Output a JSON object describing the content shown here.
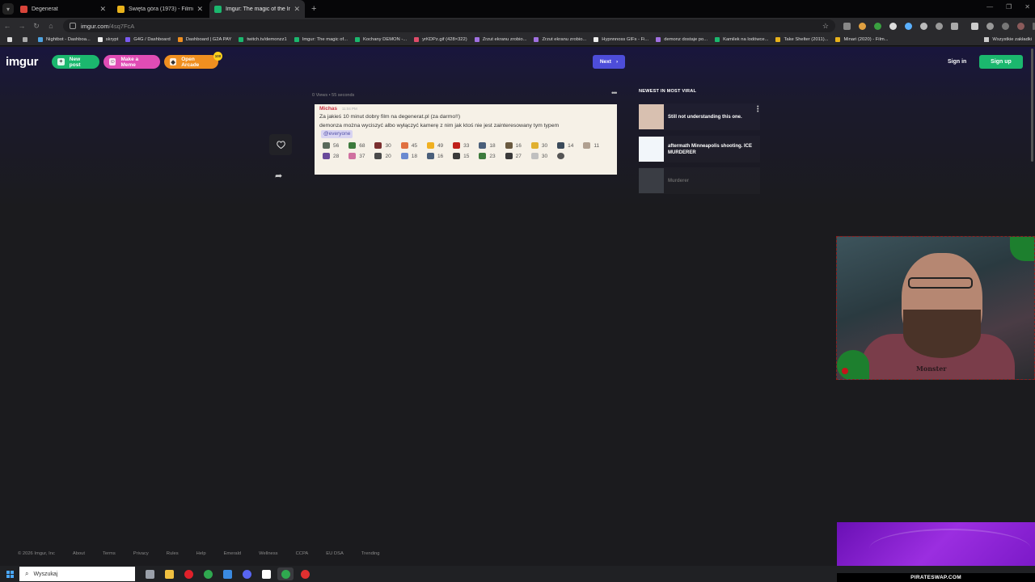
{
  "browser": {
    "tabs": [
      {
        "title": "Degenerat",
        "favicon_color": "#d8443a",
        "active": false
      },
      {
        "title": "Święta góra (1973) - Filmweb",
        "favicon_color": "#e8b21b",
        "active": false
      },
      {
        "title": "Imgur: The magic of the Internet",
        "favicon_color": "#1bb76e",
        "active": true
      }
    ],
    "url_host": "imgur.com",
    "url_path": "/4sq7FcA",
    "bookmarks": [
      {
        "label": "Nightbot - Dashboa...",
        "color": "#4fa3e0"
      },
      {
        "label": "skrypt",
        "color": "#eeeeee"
      },
      {
        "label": "G4G / Dashboard",
        "color": "#7a5af0"
      },
      {
        "label": "Dashboard | G2A PAY",
        "color": "#f08f20"
      },
      {
        "label": "twitch.tv/demonzz1",
        "color": "#1bb76e"
      },
      {
        "label": "Imgur: The magic of...",
        "color": "#1bb76e"
      },
      {
        "label": "Kochany DEMON -...",
        "color": "#1bb76e"
      },
      {
        "label": "yrKDPz.gif (428×322)",
        "color": "#e04c6a"
      },
      {
        "label": "Zrzut ekranu zrobio...",
        "color": "#a070e0"
      },
      {
        "label": "Zrzut ekranu zrobio...",
        "color": "#a070e0"
      },
      {
        "label": "Hypnnnoss GIFs - Fi...",
        "color": "#eeeeee"
      },
      {
        "label": "demonz dostaje po...",
        "color": "#a070e0"
      },
      {
        "label": "Kamilek na lodówce...",
        "color": "#1bb76e"
      },
      {
        "label": "Take Shelter (2011)...",
        "color": "#e8b21b"
      },
      {
        "label": "Minari (2020) - Film...",
        "color": "#e8b21b"
      }
    ],
    "all_bookmarks": "Wszystkie zakładki"
  },
  "header": {
    "logo": "imgur",
    "new_post": "New post",
    "make_meme": "Make a Meme",
    "open_arcade": "Open Arcade",
    "arcade_badge": "100",
    "next": "Next",
    "sign_in": "Sign in",
    "sign_up": "Sign up"
  },
  "post": {
    "meta": "0 Views • 55 seconds",
    "author": "Michas",
    "time": "11:04 PM",
    "line1": "Za jakieś 10 minut dobry film na degenerat.pl (za darmo!!)",
    "line2": "demonza można wyciszyć albo wyłączyć kamerę z nim jak ktoś nie jest zainteresowany tym typem",
    "mention": "@everyone",
    "reactions_row1": [
      {
        "count": "56",
        "color": "#5a6a5a"
      },
      {
        "count": "68",
        "color": "#3c7a3c"
      },
      {
        "count": "30",
        "color": "#7a2f2f"
      },
      {
        "count": "45",
        "color": "#e07040"
      },
      {
        "count": "49",
        "color": "#f0b020"
      },
      {
        "count": "33",
        "color": "#c0201a"
      },
      {
        "count": "18",
        "color": "#4a5f7a"
      },
      {
        "count": "16",
        "color": "#6a5a40"
      },
      {
        "count": "30",
        "color": "#e0b030"
      },
      {
        "count": "14",
        "color": "#3a4a5a"
      },
      {
        "count": "11",
        "color": "#b0a090"
      }
    ],
    "reactions_row2": [
      {
        "count": "28",
        "color": "#6a4a9a"
      },
      {
        "count": "37",
        "color": "#d070a0"
      },
      {
        "count": "20",
        "color": "#4a4a4a"
      },
      {
        "count": "18",
        "color": "#6a8ad0"
      },
      {
        "count": "16",
        "color": "#4a5f7a"
      },
      {
        "count": "15",
        "color": "#3a3a3a"
      },
      {
        "count": "23",
        "color": "#3c7a3c"
      },
      {
        "count": "27",
        "color": "#3a3a3a"
      },
      {
        "count": "30",
        "color": "#c0c0c0"
      },
      {
        "count": "",
        "color": "#555555"
      }
    ]
  },
  "sidebar": {
    "title": "NEWEST IN MOST VIRAL",
    "items": [
      {
        "title": "Still not understanding this one.",
        "thumb": "#d8c0b0"
      },
      {
        "title": "aftermath Minneapolis shooting. ICE MURDERER",
        "thumb": "#f2f6fa"
      },
      {
        "title": "Murderer",
        "thumb": "#3a3d44"
      }
    ]
  },
  "footer": {
    "links": [
      "© 2026 Imgur, Inc",
      "About",
      "Terms",
      "Privacy",
      "Rules",
      "Help",
      "Emerald",
      "Wellness",
      "CCPA",
      "EU DSA",
      "Trending"
    ]
  },
  "stream": {
    "cam_caption": "Monster",
    "ad_text": "PIRATESWAP.COM"
  },
  "taskbar": {
    "search_placeholder": "Wyszukaj",
    "apps": [
      {
        "name": "task-view",
        "color": "#9aa0aa"
      },
      {
        "name": "file-explorer",
        "color": "#f0c040"
      },
      {
        "name": "opera",
        "color": "#e0202a"
      },
      {
        "name": "chrome",
        "color": "#2fa84f"
      },
      {
        "name": "store",
        "color": "#3a8ae0"
      },
      {
        "name": "discord",
        "color": "#5865f2"
      },
      {
        "name": "notion",
        "color": "#ffffff"
      },
      {
        "name": "chrome-active",
        "color": "#2fa84f"
      },
      {
        "name": "obs",
        "color": "#e03030"
      }
    ]
  }
}
